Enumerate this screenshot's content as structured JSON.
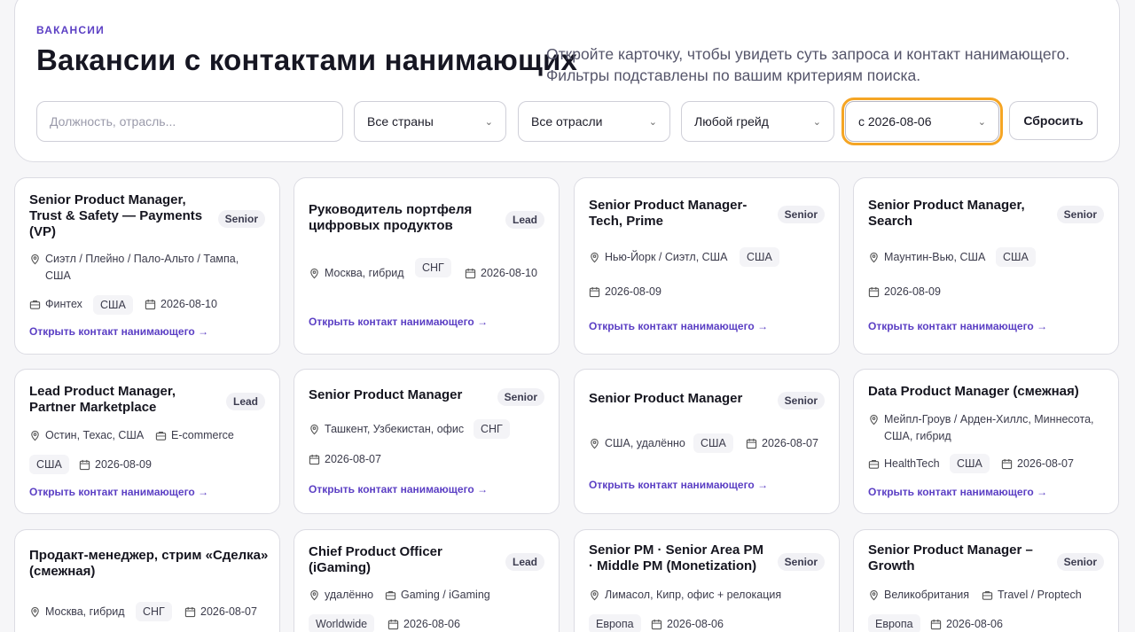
{
  "header": {
    "eyebrow": "ВАКАНСИИ",
    "title": "Вакансии с контактами нанимающих",
    "subtitle": "Откройте карточку, чтобы увидеть суть запроса и контакт нанимающего. Фильтры подставлены по вашим критериям поиска."
  },
  "filters": {
    "search_placeholder": "Должность, отрасль...",
    "country": "Все страны",
    "industry": "Все отрасли",
    "grade": "Любой грейд",
    "date": "с 2026-08-06",
    "reset_label": "Сбросить"
  },
  "link_label": "Открыть контакт нанимающего",
  "cards": [
    {
      "title": "Senior Product Manager, Trust & Safety — Payments (VP)",
      "grade": "Senior",
      "location": "Сиэтл / Плейно / Пало-Альто / Тампа, США",
      "industry": "Финтех",
      "region": "США",
      "date": "2026-08-10"
    },
    {
      "title": "Руководитель портфеля цифровых продуктов",
      "grade": "Lead",
      "location": "Москва, гибрид",
      "region": "СНГ",
      "date": "2026-08-10"
    },
    {
      "title": "Senior Product Manager-Tech, Prime",
      "grade": "Senior",
      "location": "Нью-Йорк / Сиэтл, США",
      "region": "США",
      "date": "2026-08-09"
    },
    {
      "title": "Senior Product Manager, Search",
      "grade": "Senior",
      "location": "Маунтин-Вью, США",
      "region": "США",
      "date": "2026-08-09"
    },
    {
      "title": "Lead Product Manager, Partner Marketplace",
      "grade": "Lead",
      "location": "Остин, Техас, США",
      "industry": "E-commerce",
      "region": "США",
      "date": "2026-08-09"
    },
    {
      "title": "Senior Product Manager",
      "grade": "Senior",
      "location": "Ташкент, Узбекистан, офис",
      "region": "СНГ",
      "date": "2026-08-07"
    },
    {
      "title": "Senior Product Manager",
      "grade": "Senior",
      "location": "США, удалённо",
      "region": "США",
      "date": "2026-08-07"
    },
    {
      "title": "Data Product Manager (смежная)",
      "grade": "",
      "location": "Мейпл-Гроув / Арден-Хиллс, Миннесота, США, гибрид",
      "industry": "HealthTech",
      "region": "США",
      "date": "2026-08-07"
    },
    {
      "title": "Продакт-менеджер, стрим «Сделка» (смежная)",
      "grade": "",
      "location": "Москва, гибрид",
      "region": "СНГ",
      "date": "2026-08-07"
    },
    {
      "title": "Chief Product Officer (iGaming)",
      "grade": "Lead",
      "location": "удалённо",
      "industry": "Gaming / iGaming",
      "region": "Worldwide",
      "date": "2026-08-06"
    },
    {
      "title": "Senior PM · Senior Area PM · Middle PM (Monetization)",
      "grade": "Senior",
      "location": "Лимасол, Кипр, офис + релокация",
      "region": "Европа",
      "date": "2026-08-06"
    },
    {
      "title": "Senior Product Manager – Growth",
      "grade": "Senior",
      "location": "Великобритания",
      "industry": "Travel / Proptech",
      "region": "Европа",
      "date": "2026-08-06"
    }
  ],
  "colors": {
    "accent": "#5b3fc4",
    "focus_ring": "#f5a524"
  }
}
